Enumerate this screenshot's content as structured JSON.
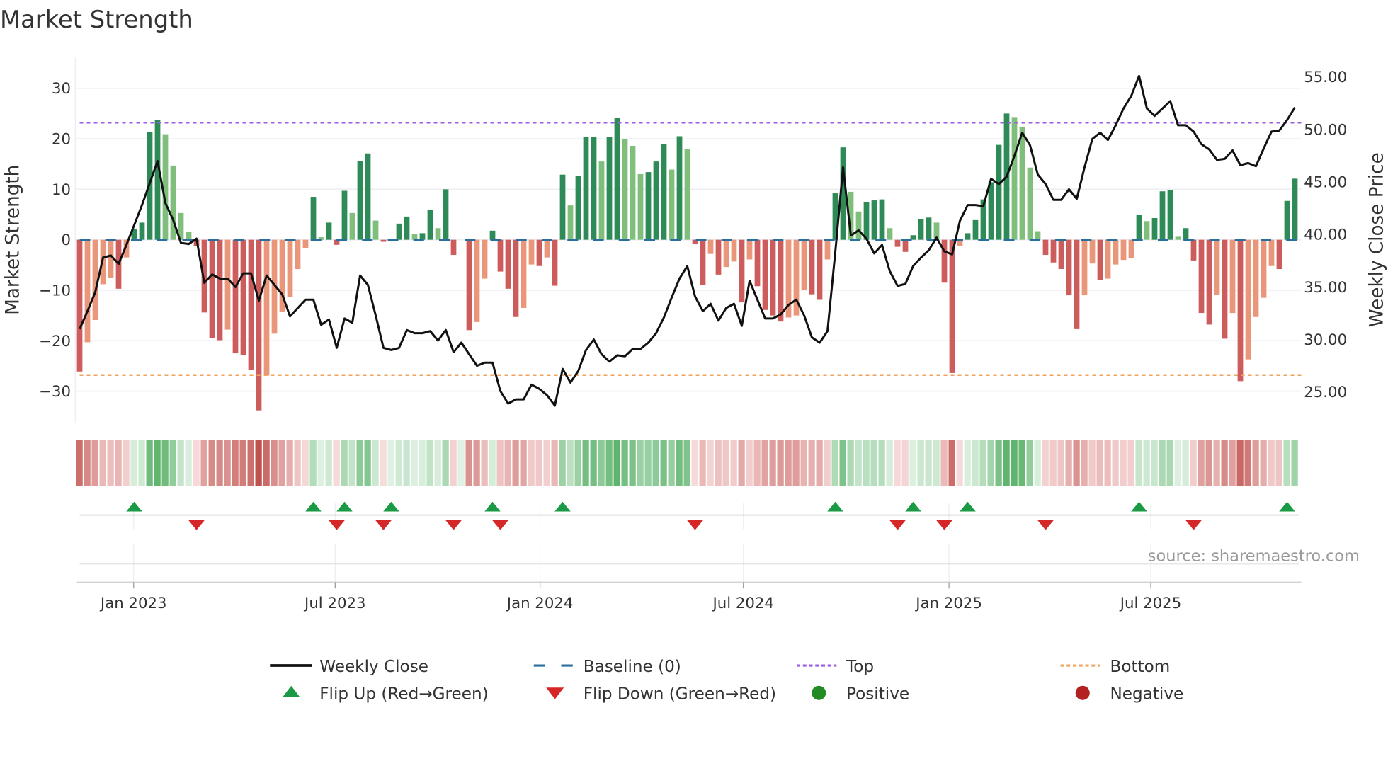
{
  "chart_data": {
    "type": "bar",
    "title": "Market Strength",
    "ylabel": "Market Strength",
    "y2label": "Weekly Close Price",
    "ylim": [
      -36.3,
      36.1
    ],
    "y2lim": [
      22.05,
      56.85
    ],
    "yticks": [
      30,
      20,
      10,
      0,
      -10,
      -20,
      -30
    ],
    "ytick_labels": [
      "30",
      "20",
      "10",
      "0",
      "−10",
      "−20",
      "−30"
    ],
    "y2ticks": [
      55,
      50,
      45,
      40,
      35,
      30,
      25
    ],
    "y2tick_labels": [
      "55.00",
      "50.00",
      "45.00",
      "40.00",
      "35.00",
      "30.00",
      "25.00"
    ],
    "x_unit": "week index",
    "xticks": [
      6.93,
      32.8,
      59.1,
      85.2,
      111.6,
      137.5
    ],
    "xtick_labels": [
      "Jan 2023",
      "Jul 2023",
      "Jan 2024",
      "Jul 2024",
      "Jan 2025",
      "Jul 2025"
    ],
    "grid": true,
    "top_level": 23.2,
    "bottom_level": -26.8,
    "baseline": 0,
    "strength": [
      -26.1,
      -20.3,
      -15.9,
      -8.8,
      -7.6,
      -9.7,
      -3.5,
      2.1,
      3.4,
      21.3,
      23.7,
      20.9,
      14.7,
      5.3,
      1.5,
      -1.3,
      -14.4,
      -19.5,
      -19.9,
      -17.8,
      -22.5,
      -22.8,
      -25.8,
      -33.8,
      -26.9,
      -18.6,
      -14.2,
      -11.4,
      -5.8,
      -1.7,
      8.5,
      0.5,
      3.4,
      -1.0,
      9.7,
      5.3,
      15.6,
      17.1,
      3.8,
      -0.4,
      0.2,
      3.2,
      4.6,
      1.2,
      1.3,
      5.9,
      2.3,
      10.0,
      -3.0,
      0.0,
      -17.9,
      -16.3,
      -7.7,
      1.8,
      -6.3,
      -9.7,
      -15.3,
      -13.5,
      -4.9,
      -5.2,
      -3.5,
      -9.1,
      12.9,
      6.8,
      12.6,
      20.3,
      20.3,
      15.5,
      20.3,
      24.1,
      19.9,
      18.6,
      13.0,
      13.4,
      15.5,
      19.0,
      13.9,
      20.5,
      17.9,
      -0.9,
      -8.9,
      -2.8,
      -6.9,
      -5.4,
      -4.3,
      -12.4,
      -3.9,
      -9.2,
      -13.9,
      -15.0,
      -16.2,
      -15.4,
      -15.0,
      -10.0,
      -10.8,
      -11.9,
      -3.9,
      9.2,
      18.3,
      9.5,
      5.6,
      7.4,
      7.8,
      8.0,
      2.3,
      -1.4,
      -2.4,
      0.9,
      4.1,
      4.4,
      3.4,
      -8.5,
      -26.4,
      -1.2,
      1.3,
      3.9,
      8.0,
      11.4,
      18.8,
      25.0,
      24.3,
      22.3,
      14.3,
      1.7,
      -3.0,
      -4.5,
      -5.8,
      -11.0,
      -17.7,
      -11.0,
      -4.7,
      -7.9,
      -7.7,
      -4.9,
      -4.0,
      -3.7,
      4.9,
      3.7,
      4.3,
      9.6,
      9.9,
      0.6,
      2.3,
      -4.1,
      -14.5,
      -16.8,
      -10.9,
      -19.6,
      -14.5,
      -28.0,
      -23.7,
      -15.3,
      -11.5,
      -5.2,
      -5.8,
      7.7,
      12.1
    ],
    "weekly_close": [
      31.0,
      32.7,
      34.5,
      37.8,
      38.0,
      37.2,
      39.0,
      40.9,
      42.8,
      44.9,
      47.0,
      43.0,
      41.4,
      39.2,
      39.1,
      39.6,
      35.4,
      36.2,
      35.8,
      35.8,
      35.0,
      36.3,
      36.3,
      33.7,
      36.1,
      35.2,
      34.3,
      32.2,
      33.0,
      33.8,
      33.8,
      31.4,
      31.9,
      29.2,
      32.0,
      31.6,
      36.1,
      35.2,
      32.3,
      29.2,
      29.0,
      29.2,
      30.9,
      30.6,
      30.6,
      30.8,
      29.9,
      30.9,
      28.8,
      29.7,
      28.6,
      27.5,
      27.8,
      27.8,
      25.1,
      23.9,
      24.3,
      24.3,
      25.7,
      25.3,
      24.7,
      23.7,
      27.2,
      25.9,
      27.0,
      29.0,
      30.0,
      28.6,
      27.9,
      28.5,
      28.4,
      29.1,
      29.1,
      29.7,
      30.6,
      32.1,
      34.0,
      35.8,
      37.0,
      34.1,
      32.7,
      33.4,
      31.8,
      33.0,
      33.4,
      31.3,
      35.6,
      33.8,
      32.0,
      32.0,
      32.4,
      33.3,
      33.8,
      32.3,
      30.2,
      29.7,
      30.8,
      38.3,
      46.4,
      39.9,
      40.4,
      39.6,
      38.2,
      39.0,
      36.5,
      35.1,
      35.3,
      37.0,
      37.8,
      38.5,
      39.7,
      38.4,
      38.1,
      41.3,
      42.8,
      42.8,
      42.7,
      45.3,
      44.8,
      45.5,
      47.5,
      49.7,
      48.5,
      45.7,
      44.8,
      43.3,
      43.3,
      44.3,
      43.4,
      46.4,
      49.1,
      49.7,
      49.0,
      50.4,
      52.0,
      53.2,
      55.1,
      52.0,
      51.3,
      52.0,
      52.7,
      50.4,
      50.4,
      49.8,
      48.6,
      48.1,
      47.1,
      47.2,
      48.0,
      46.6,
      46.8,
      46.5,
      48.2,
      49.8,
      49.9,
      50.9,
      52.1
    ],
    "flip_up_weeks": [
      7,
      30,
      34,
      40,
      53,
      62,
      97,
      107,
      114,
      136,
      155
    ],
    "flip_down_weeks": [
      15,
      33,
      39,
      48,
      54,
      79,
      105,
      111,
      124,
      143
    ],
    "legend_placement": "bottom",
    "legend": [
      {
        "key": "close",
        "label": "Weekly Close"
      },
      {
        "key": "baseline",
        "label": "Baseline (0)"
      },
      {
        "key": "top",
        "label": "Top"
      },
      {
        "key": "bottom",
        "label": "Bottom"
      },
      {
        "key": "up",
        "label": "Flip Up (Red→Green)"
      },
      {
        "key": "down",
        "label": "Flip Down (Green→Red)"
      },
      {
        "key": "pos",
        "label": "Positive"
      },
      {
        "key": "neg",
        "label": "Negative"
      }
    ],
    "source": "source: sharemaestro.com"
  },
  "colors": {
    "pos_dark": "#2e8b57",
    "pos_light": "#7fbf7b",
    "neg_dark": "#cd5c5c",
    "neg_light": "#e9967a",
    "close": "#111111",
    "baseline": "#2b6f9e",
    "top": "#9b5de5",
    "bottom": "#f0a35e",
    "up_marker": "#1a9a44",
    "down_marker": "#d62728",
    "pos_legend": "#228b22",
    "neg_legend": "#b22222"
  }
}
